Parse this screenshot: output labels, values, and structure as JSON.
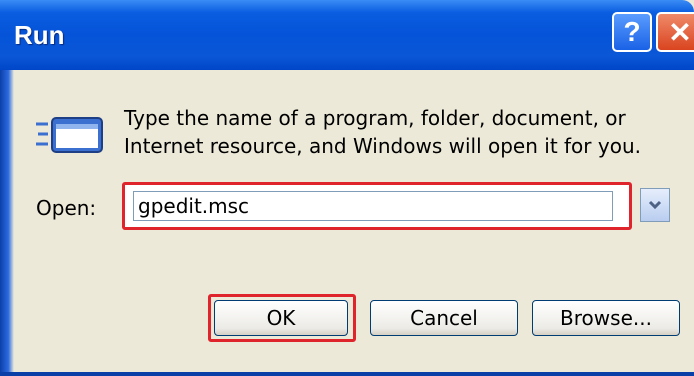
{
  "window": {
    "title": "Run"
  },
  "titlebar": {
    "help_label": "?",
    "close_label": "✕"
  },
  "description": {
    "line1": "Type the name of a program, folder, document, or",
    "line2": "Internet resource, and Windows will open it for you."
  },
  "open_field": {
    "label": "Open:",
    "value": "gpedit.msc"
  },
  "buttons": {
    "ok": "OK",
    "cancel": "Cancel",
    "browse": "Browse..."
  },
  "colors": {
    "titlebar": "#0553d8",
    "highlight": "#e0242c",
    "dialog_bg": "#ece9d8"
  },
  "icons": {
    "run": "run-window-icon",
    "dropdown": "chevron-down-icon"
  }
}
